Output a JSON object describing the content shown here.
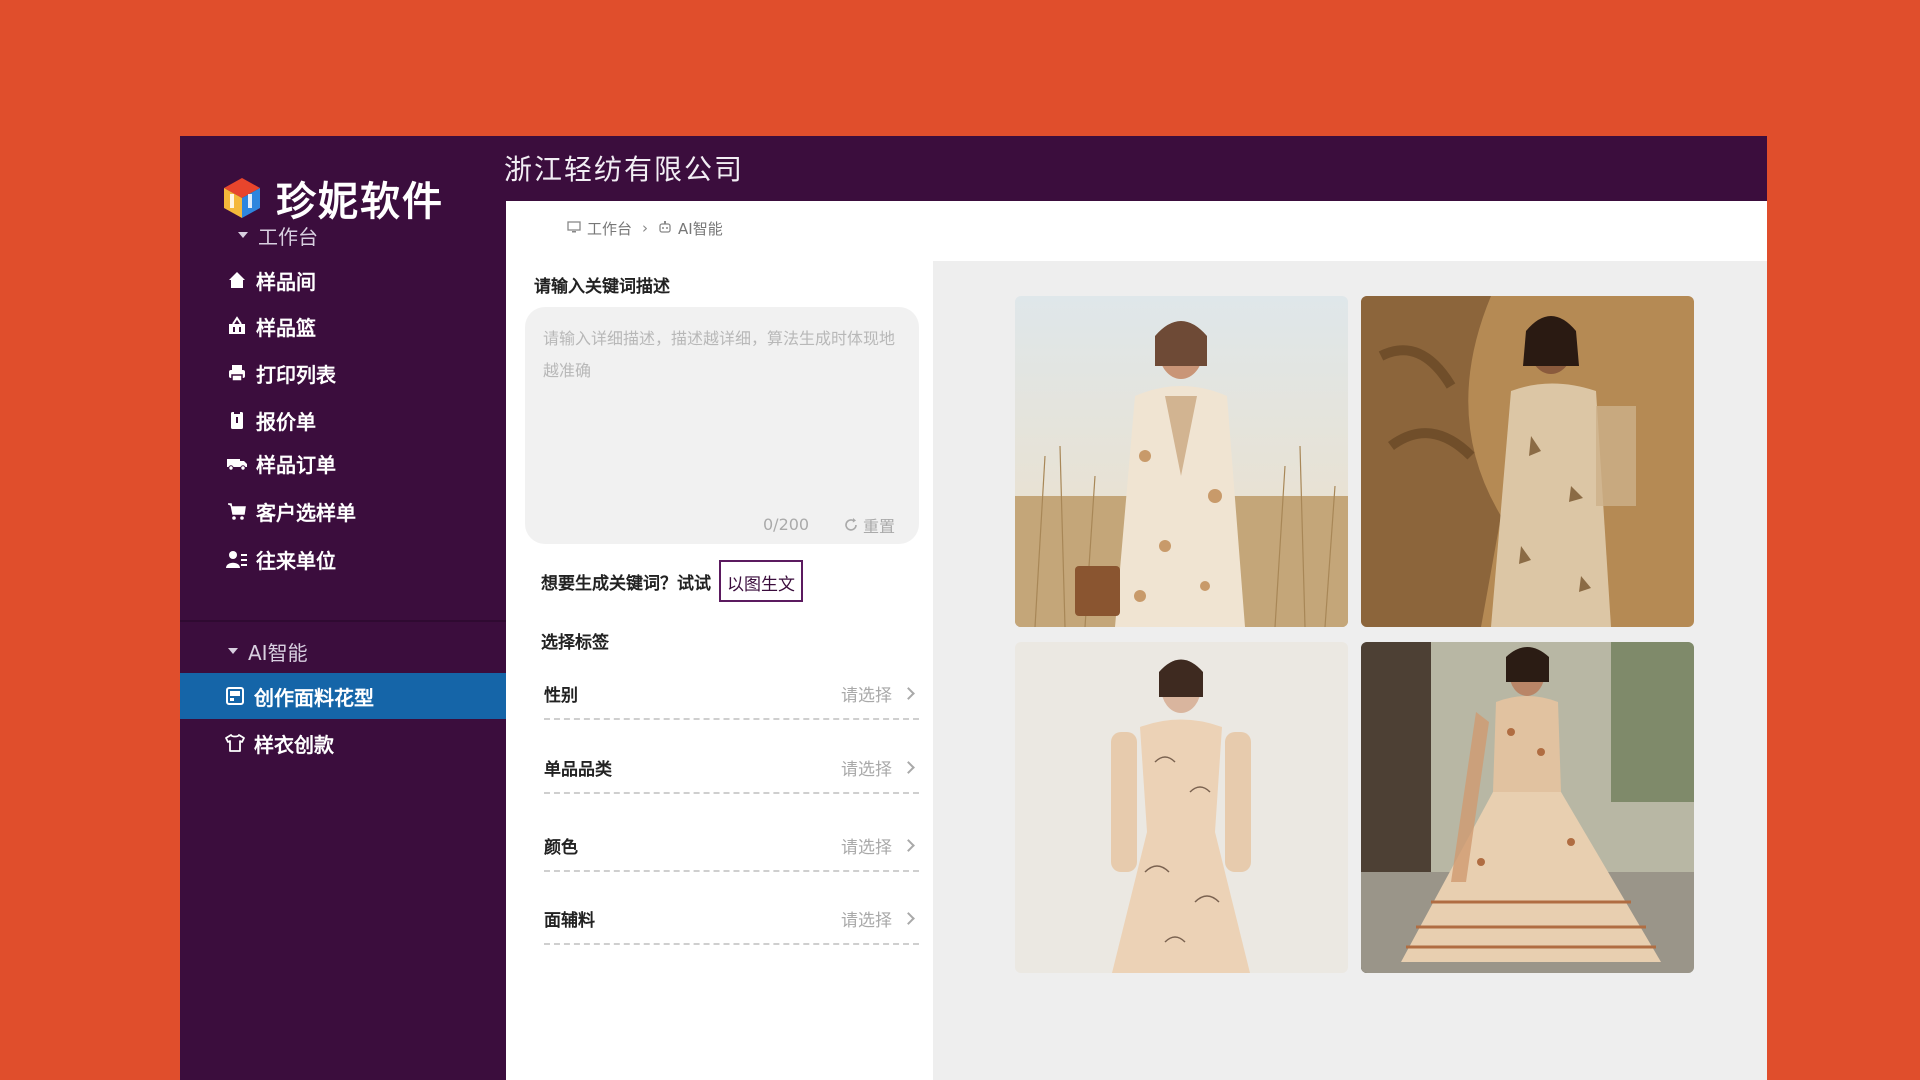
{
  "brand": {
    "name": "珍妮软件"
  },
  "header": {
    "company": "浙江轻纺有限公司"
  },
  "breadcrumb": {
    "home": "工作台",
    "current": "AI智能"
  },
  "sidebar": {
    "groups": [
      {
        "label": "工作台",
        "items": [
          {
            "label": "样品间",
            "icon": "home-icon"
          },
          {
            "label": "样品篮",
            "icon": "basket-icon"
          },
          {
            "label": "打印列表",
            "icon": "printer-icon"
          },
          {
            "label": "报价单",
            "icon": "clipboard-icon"
          },
          {
            "label": "样品订单",
            "icon": "truck-icon"
          },
          {
            "label": "客户选样单",
            "icon": "cart-icon"
          },
          {
            "label": "往来单位",
            "icon": "contacts-icon"
          }
        ]
      },
      {
        "label": "AI智能",
        "items": [
          {
            "label": "创作面料花型",
            "icon": "palette-icon",
            "active": true
          },
          {
            "label": "样衣创款",
            "icon": "shirt-icon"
          }
        ]
      }
    ]
  },
  "form": {
    "keyword_label": "请输入关键词描述",
    "textarea_value": "",
    "textarea_placeholder": "请输入详细描述，描述越详细，算法生成时体现地越准确",
    "counter": "0/200",
    "reset_label": "重置",
    "generate_prompt": "想要生成关键词？试试",
    "img2text_label": "以图生文",
    "tags_title": "选择标签",
    "fields": [
      {
        "name": "性别",
        "value": "请选择"
      },
      {
        "name": "单品品类",
        "value": "请选择"
      },
      {
        "name": "颜色",
        "value": "请选择"
      },
      {
        "name": "面辅料",
        "value": "请选择"
      }
    ]
  },
  "colors": {
    "background": "#E04E2C",
    "sidebar": "#3B0D3D",
    "active_item": "#1565A8",
    "gallery_bg": "#EEEEEE"
  }
}
